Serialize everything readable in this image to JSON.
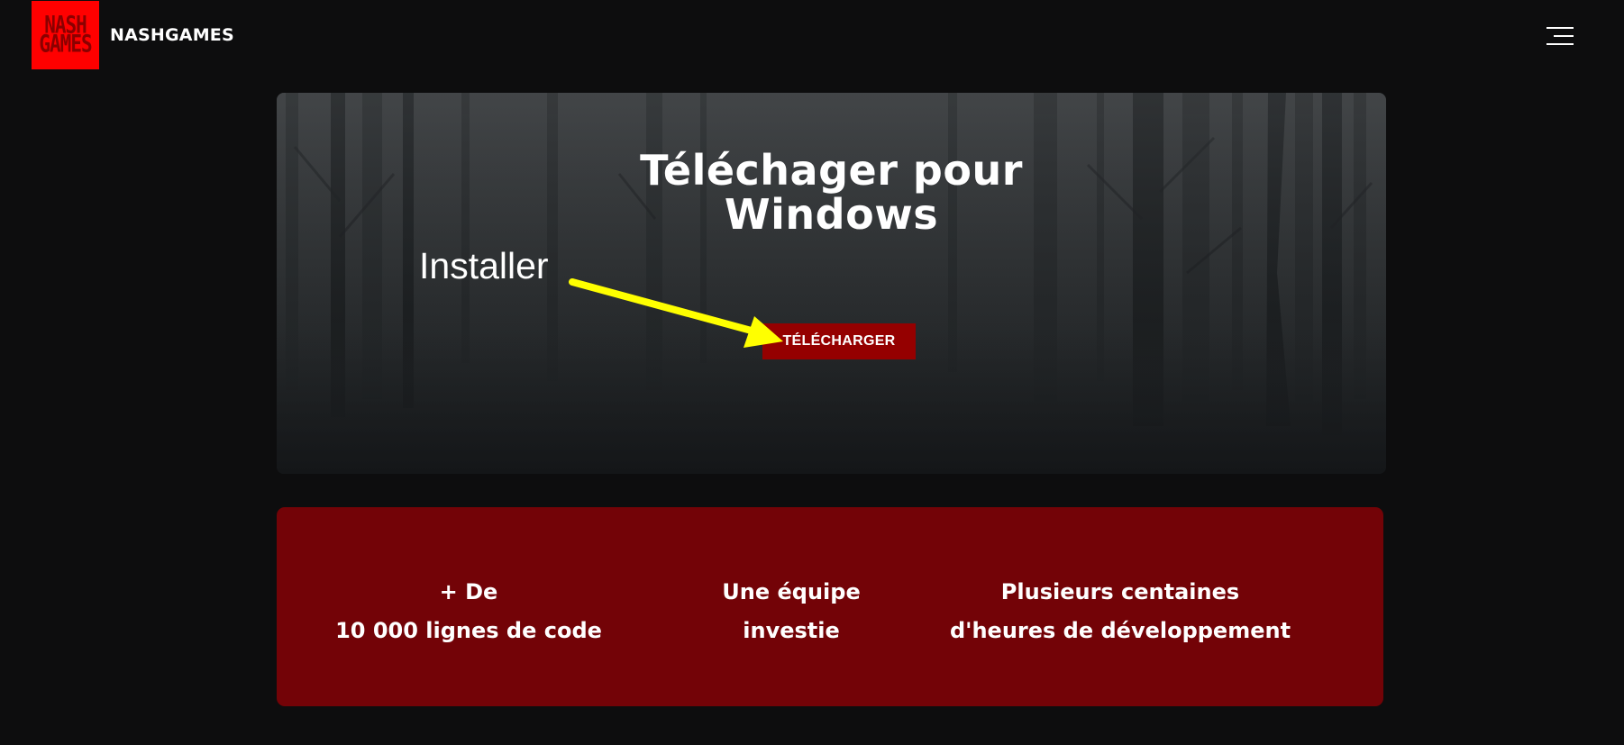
{
  "header": {
    "logo": {
      "line1": "NASH",
      "line2": "GAMES",
      "background": "#ff0000",
      "text_color": "#8a0000"
    },
    "brand": "NASHGAMES",
    "menu_icon": "hamburger-menu-icon"
  },
  "hero": {
    "title_line1": "Téléchager pour",
    "title_line2": "Windows",
    "annotation": "Installer",
    "annotation_arrow_color": "#ffff00",
    "button_label": "TÉLÉCHARGER",
    "button_color": "#950000"
  },
  "stats": {
    "background": "#730307",
    "items": [
      {
        "line1": "+ De",
        "line2": "10 000 lignes de code"
      },
      {
        "line1": "Une équipe",
        "line2": "investie"
      },
      {
        "line1": "Plusieurs centaines",
        "line2": "d'heures de développement"
      }
    ]
  }
}
